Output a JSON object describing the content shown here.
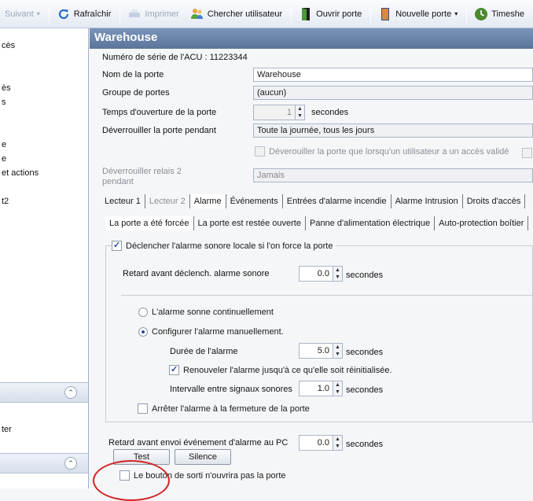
{
  "toolbar": {
    "next": "Suivant",
    "refresh": "Rafraîchir",
    "print": "Imprimer",
    "search_user": "Chercher utilisateur",
    "open_door": "Ouvrir porte",
    "new_door": "Nouvelle porte",
    "timesheet": "Timeshe"
  },
  "left": {
    "items": [
      "cès",
      "ès",
      "s",
      "e",
      "e",
      "et actions",
      "t2"
    ],
    "bottom_item": "ter"
  },
  "door": {
    "title": "Warehouse",
    "serial_label": "Numéro de série de l'ACU : 11223344",
    "name_label": "Nom de la porte",
    "name_value": "Warehouse",
    "group_label": "Groupe de portes",
    "group_value": "(aucun)",
    "open_time_label": "Temps d'ouverture de la porte",
    "open_time_value": "1",
    "open_time_unit": "secondes",
    "unlock_label": "Déverrouiller la porte pendant",
    "unlock_value": "Toute la journée, tous les jours",
    "unlock_valid_label": "Déverouiller la porte que lorsqu'un utilisateur a un accès validé",
    "relay_label_1": "Déverrouiller relais 2",
    "relay_label_2": "pendant",
    "relay_value": "Jamais"
  },
  "tabs": [
    "Lecteur 1",
    "Lecteur 2",
    "Alarme",
    "Événements",
    "Entrées d'alarme incendie",
    "Alarme Intrusion",
    "Droits d'accès"
  ],
  "subtabs": [
    "La porte a été forcée",
    "La porte est restée ouverte",
    "Panne d'alimentation électrique",
    "Auto-protection boîtier"
  ],
  "alarm": {
    "trigger_label": "Déclencher l'alarme sonore locale si l'on force la porte",
    "delay_label": "Retard avant déclench. alarme sonore",
    "delay_value": "0.0",
    "unit": "secondes",
    "continuous_label": "L'alarme sonne continuellement",
    "manual_label": "Configurer l'alarme manuellement.",
    "duration_label": "Durée de l'alarme",
    "duration_value": "5.0",
    "renew_label": "Renouveler l'alarme jusqu'à ce qu'elle soit réinitialisée.",
    "interval_label": "Intervalle entre signaux sonores",
    "interval_value": "1.0",
    "stop_on_close_label": "Arrêter l'alarme à la fermeture de la porte",
    "pc_delay_label": "Retard avant envoi événement d'alarme au PC",
    "pc_delay_value": "0.0",
    "test_label": "Test",
    "silence_label": "Silence",
    "exit_button_label": "Le bouton de sorti n'ouvrira pas la porte"
  }
}
